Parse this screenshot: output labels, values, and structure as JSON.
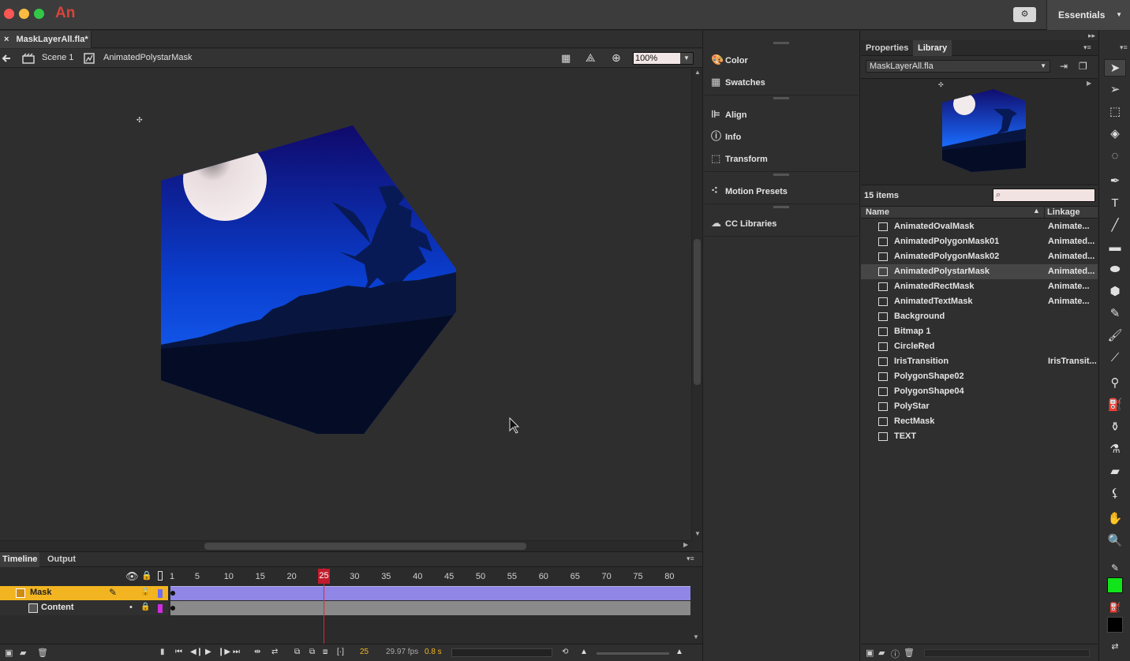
{
  "app": {
    "logo": "An",
    "workspace": "Essentials",
    "sync_icon": "sync-settings-icon"
  },
  "document": {
    "tab": "MaskLayerAll.fla*",
    "close": "×"
  },
  "editbar": {
    "scene": "Scene 1",
    "symbol": "AnimatedPolystarMask",
    "zoom": "100%"
  },
  "timeline": {
    "tabs": [
      "Timeline",
      "Output"
    ],
    "frame_numbers": [
      1,
      5,
      10,
      15,
      20,
      25,
      30,
      35,
      40,
      45,
      50,
      55,
      60,
      65,
      70,
      75,
      80
    ],
    "current_frame": "25",
    "layers": [
      {
        "name": "Mask",
        "color": "#6f6cf0"
      },
      {
        "name": "Content",
        "color": "#d12ce0"
      }
    ],
    "footer": {
      "frame": "25",
      "fps": "29.97 fps",
      "time": "0.8 s"
    }
  },
  "panels": {
    "items": [
      {
        "label": "Color",
        "icon": "palette-icon"
      },
      {
        "label": "Swatches",
        "icon": "swatches-icon"
      },
      {
        "label": "Align",
        "icon": "align-icon"
      },
      {
        "label": "Info",
        "icon": "info-icon"
      },
      {
        "label": "Transform",
        "icon": "transform-icon"
      },
      {
        "label": "Motion Presets",
        "icon": "motion-presets-icon"
      },
      {
        "label": "CC Libraries",
        "icon": "cc-libraries-icon"
      }
    ]
  },
  "library": {
    "tabs": [
      "Properties",
      "Library"
    ],
    "file": "MaskLayerAll.fla",
    "count": "15 items",
    "col_name": "Name",
    "col_linkage": "Linkage",
    "items": [
      {
        "name": "AnimatedOvalMask",
        "linkage": "Animate..."
      },
      {
        "name": "AnimatedPolygonMask01",
        "linkage": "Animated..."
      },
      {
        "name": "AnimatedPolygonMask02",
        "linkage": "Animated..."
      },
      {
        "name": "AnimatedPolystarMask",
        "linkage": "Animated..."
      },
      {
        "name": "AnimatedRectMask",
        "linkage": "Animate..."
      },
      {
        "name": "AnimatedTextMask",
        "linkage": "Animate..."
      },
      {
        "name": "Background",
        "linkage": ""
      },
      {
        "name": "Bitmap 1",
        "linkage": ""
      },
      {
        "name": "CircleRed",
        "linkage": ""
      },
      {
        "name": "IrisTransition",
        "linkage": "IrisTransit..."
      },
      {
        "name": "PolygonShape02",
        "linkage": ""
      },
      {
        "name": "PolygonShape04",
        "linkage": ""
      },
      {
        "name": "PolyStar",
        "linkage": ""
      },
      {
        "name": "RectMask",
        "linkage": ""
      },
      {
        "name": "TEXT",
        "linkage": ""
      }
    ],
    "selected": "AnimatedPolystarMask"
  },
  "colors": {
    "stroke": "#11e51a",
    "fill": "#000000",
    "accent_layer": "#f2b521"
  }
}
